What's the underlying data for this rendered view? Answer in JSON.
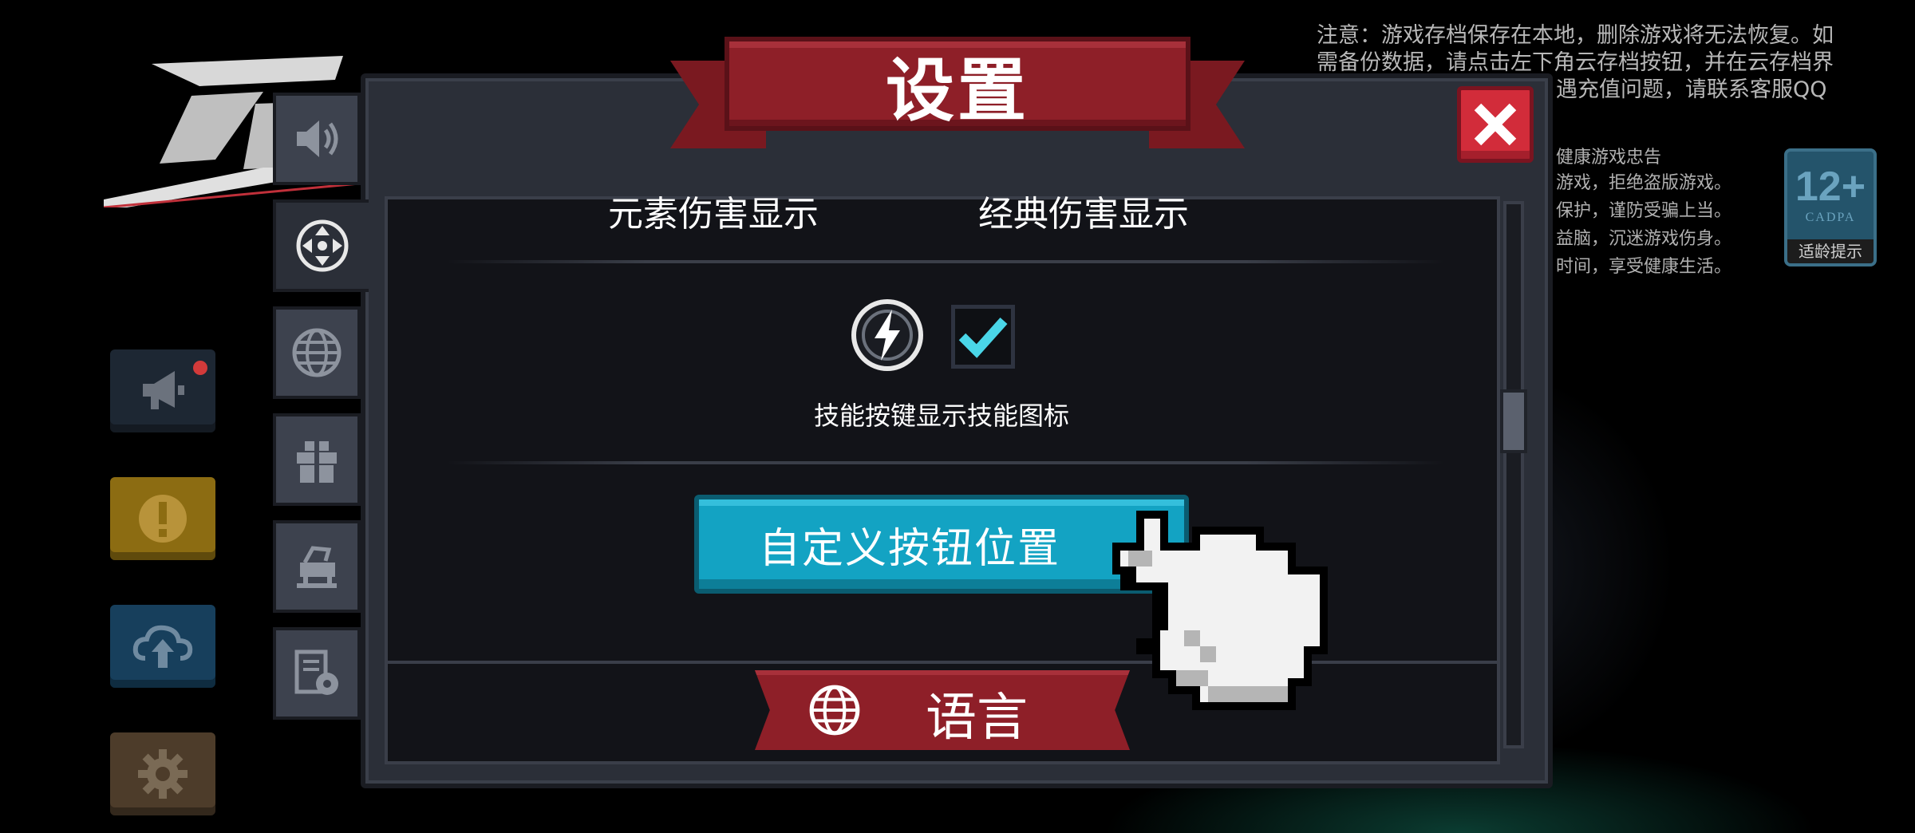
{
  "notice": {
    "line1": "注意：游戏存档保存在本地，删除游戏将无法恢复。如",
    "line2": "需备份数据，请点击左下角云存档按钮，并在云存档界",
    "line3": "遇充值问题，请联系客服QQ"
  },
  "health": {
    "title": "健康游戏忠告",
    "line1": "游戏，拒绝盗版游戏。",
    "line2": "保护，谨防受骗上当。",
    "line3": "益脑，沉迷游戏伤身。",
    "line4": "时间，享受健康生活。"
  },
  "age_badge": {
    "rating": "12+",
    "org": "CADPA",
    "tip": "适龄提示"
  },
  "quick_buttons": {
    "announce_icon": "megaphone-icon",
    "alert_icon": "exclamation-icon",
    "cloud_icon": "cloud-upload-icon",
    "settings_icon": "gear-icon"
  },
  "tabs": [
    {
      "icon": "speaker-icon"
    },
    {
      "icon": "move-control-icon",
      "active": true
    },
    {
      "icon": "globe-icon"
    },
    {
      "icon": "gift-icon"
    },
    {
      "icon": "cart-icon"
    },
    {
      "icon": "document-gear-icon"
    }
  ],
  "panel": {
    "title": "设置",
    "element_damage_label": "元素伤害显示",
    "classic_damage_label": "经典伤害显示",
    "skill_icon_label": "技能按键显示技能图标",
    "skill_icon_checked": true,
    "custom_button_label": "自定义按钮位置",
    "language_label": "语言"
  },
  "colors": {
    "ribbon_red": "#8e1f28",
    "close_red": "#d22c3a",
    "button_cyan": "#13a3c3",
    "check_cyan": "#4ad6e8",
    "panel_bg": "#2b2f38"
  }
}
